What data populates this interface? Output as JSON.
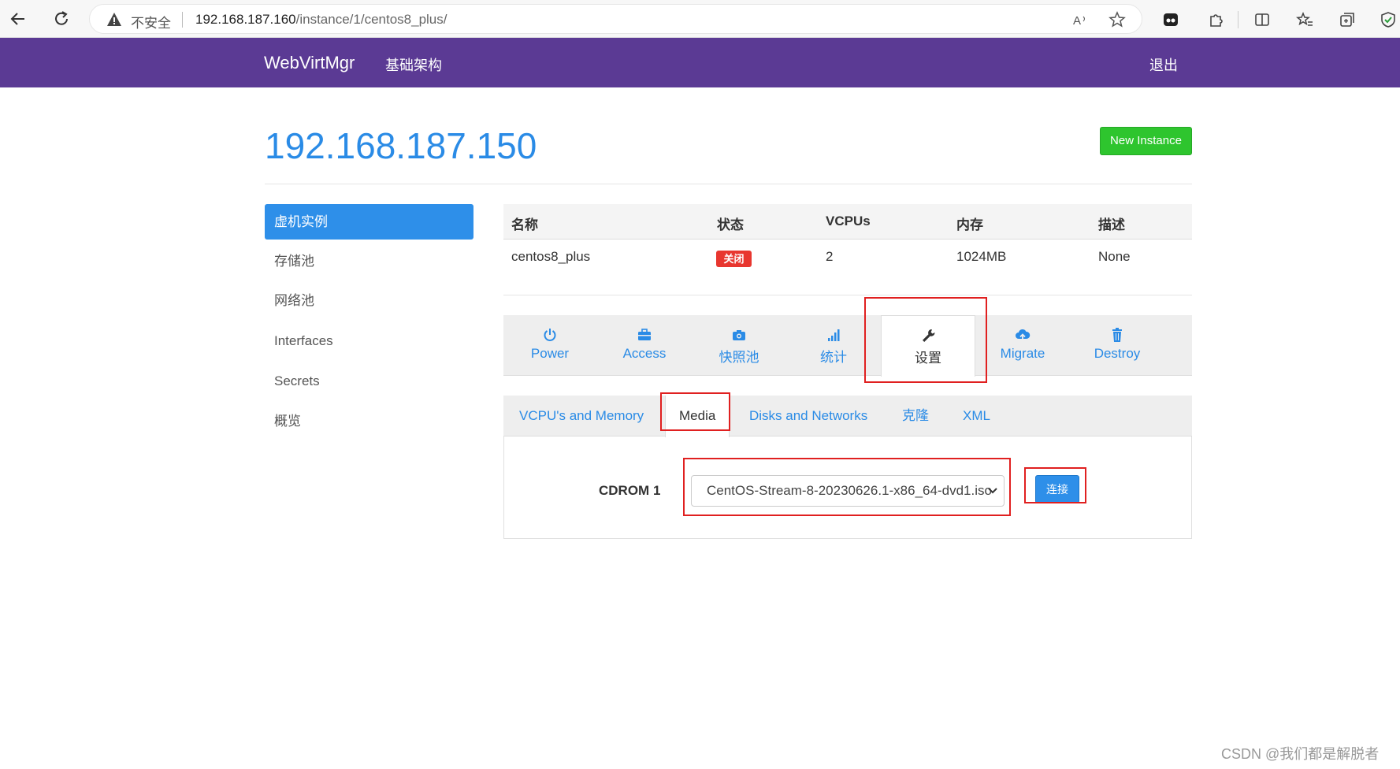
{
  "browser": {
    "insecure_label": "不安全",
    "url_host": "192.168.187.160",
    "url_path": "/instance/1/centos8_plus/"
  },
  "navbar": {
    "brand": "WebVirtMgr",
    "link": "基础架构",
    "logout": "退出"
  },
  "header": {
    "title": "192.168.187.150",
    "new_instance": "New Instance"
  },
  "sidebar": {
    "items": [
      {
        "label": "虚机实例",
        "active": true
      },
      {
        "label": "存储池"
      },
      {
        "label": "网络池"
      },
      {
        "label": "Interfaces"
      },
      {
        "label": "Secrets"
      },
      {
        "label": "概览"
      }
    ]
  },
  "table": {
    "headers": [
      "名称",
      "状态",
      "VCPUs",
      "内存",
      "描述"
    ],
    "row": {
      "name": "centos8_plus",
      "status": "关闭",
      "vcpus": "2",
      "memory": "1024MB",
      "description": "None"
    }
  },
  "action_tabs": [
    {
      "label": "Power",
      "icon": "power-icon"
    },
    {
      "label": "Access",
      "icon": "briefcase-icon"
    },
    {
      "label": "快照池",
      "icon": "camera-icon"
    },
    {
      "label": "统计",
      "icon": "signal-icon"
    },
    {
      "label": "设置",
      "icon": "wrench-icon",
      "active": true
    },
    {
      "label": "Migrate",
      "icon": "cloud-upload-icon"
    },
    {
      "label": "Destroy",
      "icon": "trash-icon"
    }
  ],
  "sub_tabs": [
    {
      "label": "VCPU's and Memory"
    },
    {
      "label": "Media",
      "active": true
    },
    {
      "label": "Disks and Networks"
    },
    {
      "label": "克隆"
    },
    {
      "label": "XML"
    }
  ],
  "media": {
    "cdrom_label": "CDROM 1",
    "cdrom_selected": "CentOS-Stream-8-20230626.1-x86_64-dvd1.iso",
    "connect_label": "连接"
  },
  "colors": {
    "navbar": "#5b3a94",
    "accent": "#2a8be6",
    "success": "#2ec52e",
    "danger": "#e8362f",
    "annotation": "#e02020"
  },
  "watermark": "CSDN @我们都是解脱者"
}
